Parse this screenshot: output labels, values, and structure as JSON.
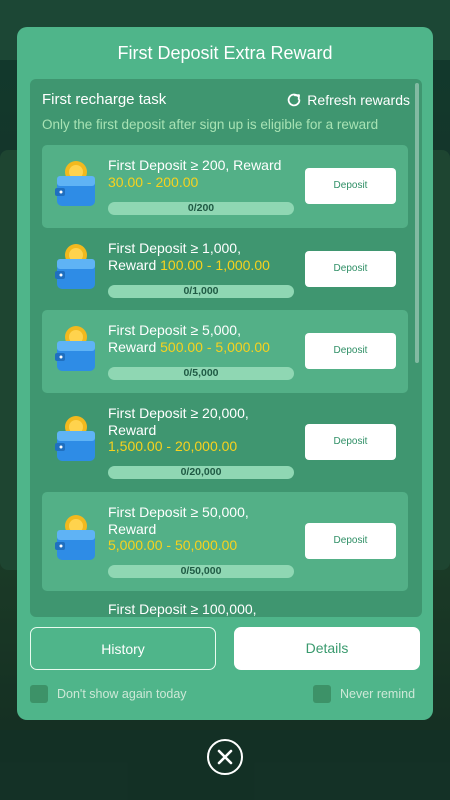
{
  "modal": {
    "title": "First Deposit Extra Reward",
    "task_title": "First recharge task",
    "refresh_label": "Refresh rewards",
    "note": "Only the first deposit after sign up is eligible for a reward"
  },
  "tasks": [
    {
      "line1": "First Deposit ≥ 200, Reward",
      "line2": "",
      "reward": "30.00 - 200.00",
      "progress": "0/200",
      "button": "Deposit"
    },
    {
      "line1": "First Deposit ≥ 1,000,",
      "line2": "Reward",
      "reward": "100.00 - 1,000.00",
      "progress": "0/1,000",
      "button": "Deposit"
    },
    {
      "line1": "First Deposit ≥ 5,000,",
      "line2": "Reward",
      "reward": "500.00 - 5,000.00",
      "progress": "0/5,000",
      "button": "Deposit"
    },
    {
      "line1": "First Deposit ≥ 20,000,",
      "line2": "Reward",
      "reward": "1,500.00 - 20,000.00",
      "progress": "0/20,000",
      "button": "Deposit"
    },
    {
      "line1": "First Deposit ≥ 50,000,",
      "line2": "Reward",
      "reward": "5,000.00 - 50,000.00",
      "progress": "0/50,000",
      "button": "Deposit"
    },
    {
      "line1": "First Deposit ≥ 100,000,"
    }
  ],
  "footer": {
    "history_label": "History",
    "details_label": "Details",
    "dont_show_label": "Don't show again today",
    "never_remind_label": "Never remind"
  },
  "icons": {
    "refresh": "refresh-icon",
    "wallet": "wallet-coin-icon",
    "close": "close-icon"
  },
  "colors": {
    "modal_bg": "#4fb58a",
    "panel_bg": "#3f9670",
    "reward_gold": "#f7d21e",
    "note_green": "#a8e3b4"
  }
}
